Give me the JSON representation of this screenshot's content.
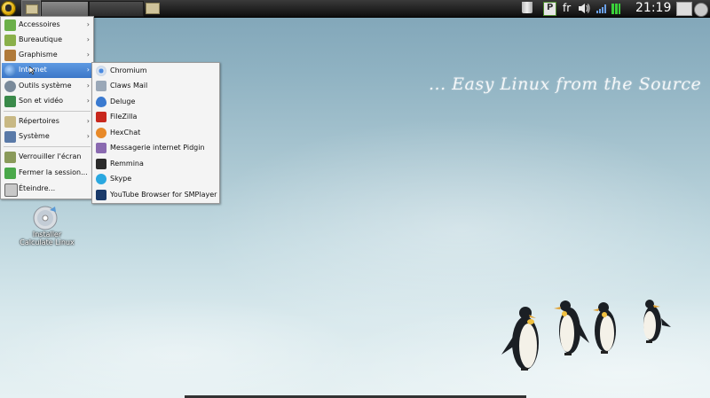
{
  "panel": {
    "language": "fr",
    "clock": "21:19"
  },
  "main_menu": {
    "items": [
      {
        "label": "Accessoires",
        "icon": "accessories-icon",
        "submenu": true
      },
      {
        "label": "Bureautique",
        "icon": "office-icon",
        "submenu": true
      },
      {
        "label": "Graphisme",
        "icon": "graphics-icon",
        "submenu": true
      },
      {
        "label": "Internet",
        "icon": "internet-globe-icon",
        "submenu": true,
        "selected": true
      },
      {
        "label": "Outils système",
        "icon": "system-tools-icon",
        "submenu": true
      },
      {
        "label": "Son et vidéo",
        "icon": "sound-video-icon",
        "submenu": true
      },
      {
        "label": "Répertoires",
        "icon": "folders-icon",
        "submenu": true
      },
      {
        "label": "Système",
        "icon": "system-icon",
        "submenu": true
      },
      {
        "label": "Verrouiller l'écran",
        "icon": "lock-screen-icon",
        "submenu": false
      },
      {
        "label": "Fermer la session...",
        "icon": "logout-icon",
        "submenu": false
      },
      {
        "label": "Éteindre...",
        "icon": "shutdown-icon",
        "submenu": false
      }
    ],
    "arrow": "›"
  },
  "internet_submenu": {
    "items": [
      {
        "label": "Chromium",
        "icon": "chromium-icon"
      },
      {
        "label": "Claws Mail",
        "icon": "claws-mail-icon"
      },
      {
        "label": "Deluge",
        "icon": "deluge-icon"
      },
      {
        "label": "FileZilla",
        "icon": "filezilla-icon"
      },
      {
        "label": "HexChat",
        "icon": "hexchat-icon"
      },
      {
        "label": "Messagerie internet Pidgin",
        "icon": "pidgin-icon"
      },
      {
        "label": "Remmina",
        "icon": "remmina-icon"
      },
      {
        "label": "Skype",
        "icon": "skype-icon"
      },
      {
        "label": "YouTube Browser for SMPlayer",
        "icon": "smplayer-youtube-icon"
      }
    ]
  },
  "desktop": {
    "tagline": "... Easy Linux from the Source",
    "install_icon_label": "Installer Calculate Linux"
  },
  "colors": {
    "selection": "#4a86d2",
    "menu_bg": "#f4f4f4",
    "panel_bg": "#1a1a1a"
  }
}
